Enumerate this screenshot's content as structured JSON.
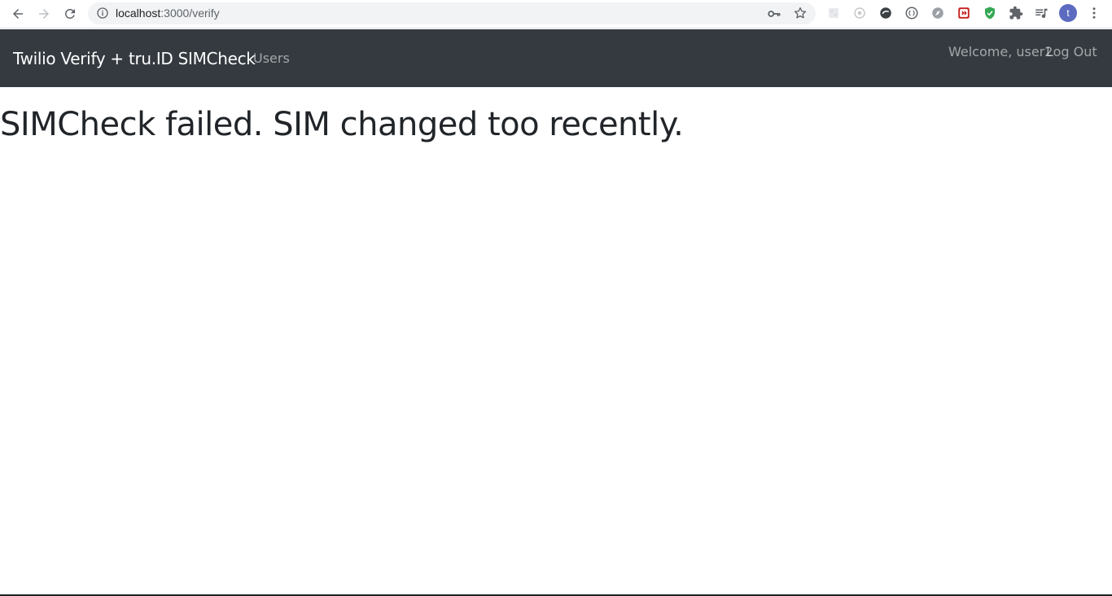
{
  "browser": {
    "url_host": "localhost",
    "url_rest": ":3000/verify",
    "avatar_letter": "t",
    "icons": {
      "back": "back-arrow-icon",
      "forward": "forward-arrow-icon",
      "reload": "reload-icon",
      "info": "info-icon",
      "key": "key-icon",
      "star": "bookmark-star-icon"
    }
  },
  "navbar": {
    "brand": "Twilio Verify + tru.ID SIMCheck",
    "users_link": "Users",
    "welcome": "Welcome, user2",
    "logout": "Log Out",
    "background": "#343a40"
  },
  "main": {
    "heading": "SIMCheck failed. SIM changed too recently."
  }
}
